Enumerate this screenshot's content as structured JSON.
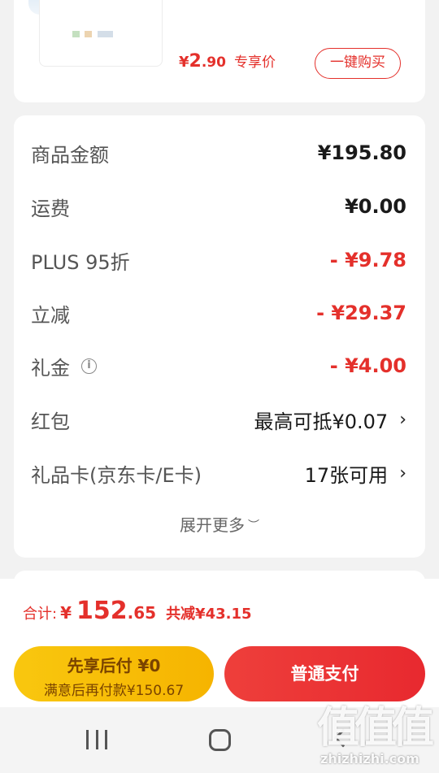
{
  "recommend": {
    "price_currency": "¥",
    "price_int": "2",
    "price_dec": ".90",
    "price_tag": "专享价",
    "buy_button": "一键购买"
  },
  "summary": {
    "rows": [
      {
        "label": "商品金额",
        "value": "¥195.80"
      },
      {
        "label": "运费",
        "value": "¥0.00"
      },
      {
        "label": "PLUS 95折",
        "value": "- ¥9.78"
      },
      {
        "label": "立减",
        "value": "- ¥29.37"
      },
      {
        "label": "礼金",
        "value": "- ¥4.00"
      },
      {
        "label": "红包",
        "value": "最高可抵¥0.07"
      },
      {
        "label": "礼品卡(京东卡/E卡)",
        "value": "17张可用"
      }
    ],
    "expand_more": "展开更多"
  },
  "bottom": {
    "total_label": "合计:",
    "total_currency": "¥",
    "total_int": "152",
    "total_dec": ".65",
    "total_saved": "共减¥43.15",
    "pay_later_title": "先享后付 ¥0",
    "pay_later_sub": "满意后再付款¥150.67",
    "pay_normal": "普通支付"
  },
  "watermark": {
    "logo_text": "值值值",
    "url": "zhizhizhi.com"
  },
  "colors": {
    "accent_red": "#e4302b",
    "pay_later_yellow": "#f9c70f"
  }
}
